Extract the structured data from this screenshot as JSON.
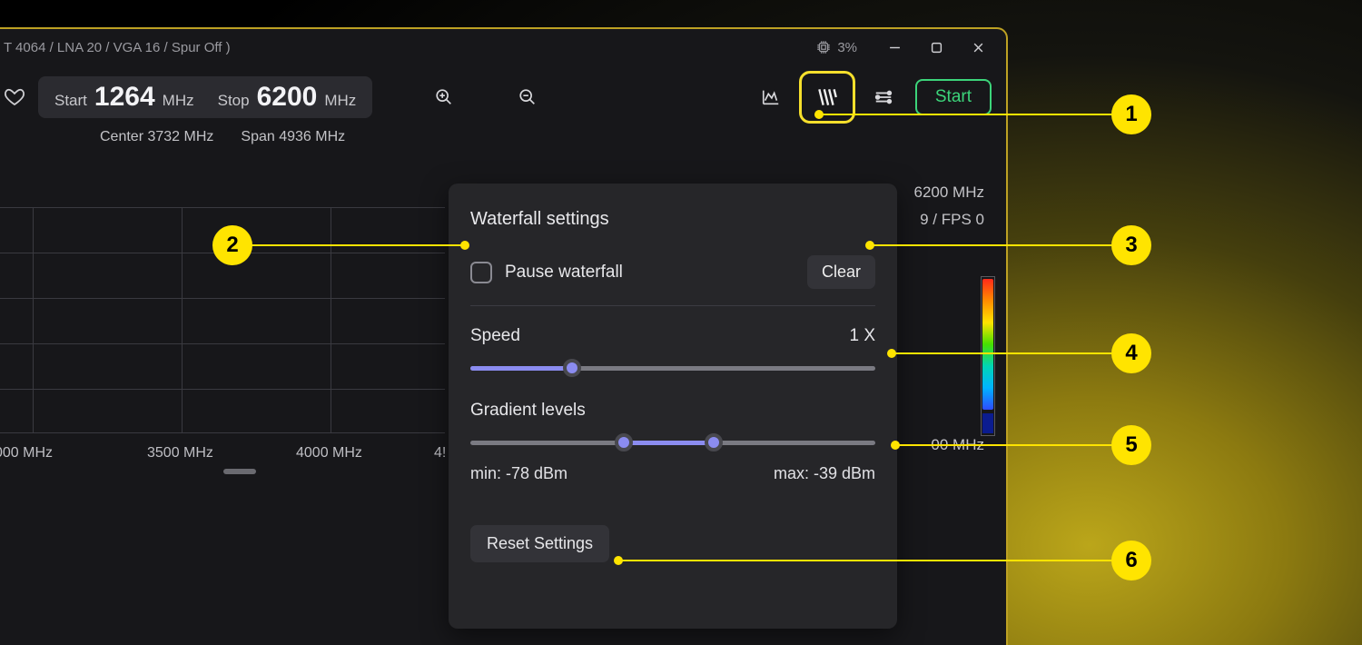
{
  "titlebar": {
    "device_info": "T 4064 / LNA 20 / VGA 16 / Spur Off )",
    "cpu_pct": "3%"
  },
  "toolbar": {
    "start_label": "Start",
    "freq_start_label": "Start",
    "freq_start_value": "1264",
    "freq_start_unit": "MHz",
    "freq_stop_label": "Stop",
    "freq_stop_value": "6200",
    "freq_stop_unit": "MHz"
  },
  "inforow": {
    "center": "Center 3732 MHz",
    "span": "Span 4936 MHz"
  },
  "right_readouts": {
    "stop_freq": "6200 MHz",
    "fps": "9 / FPS 0"
  },
  "x_axis": {
    "t0": "000 MHz",
    "t1": "3500 MHz",
    "t2": "4000 MHz",
    "t3": "4!",
    "right": "00 MHz"
  },
  "panel": {
    "title": "Waterfall settings",
    "pause_label": "Pause waterfall",
    "clear_label": "Clear",
    "speed_label": "Speed",
    "speed_value": "1 X",
    "speed_fraction": 0.25,
    "gradient_label": "Gradient levels",
    "gradient_low": 0.38,
    "gradient_high": 0.6,
    "min_text": "min: -78 dBm",
    "max_text": "max: -39 dBm",
    "reset_label": "Reset Settings"
  },
  "annotations": {
    "n1": "1",
    "n2": "2",
    "n3": "3",
    "n4": "4",
    "n5": "5",
    "n6": "6"
  }
}
